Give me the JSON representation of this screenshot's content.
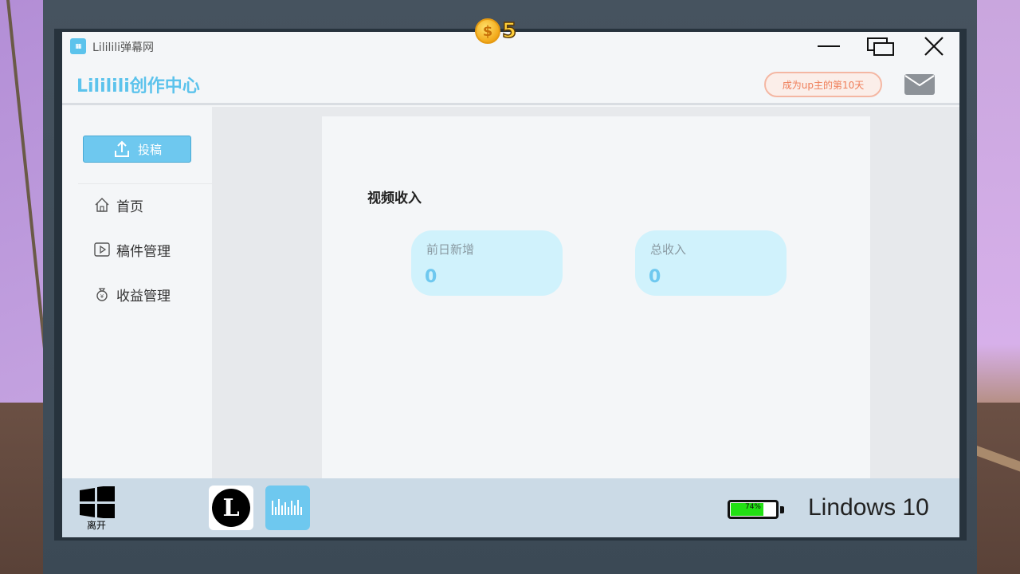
{
  "hud": {
    "coin_icon": "coin-icon",
    "coin_count": "5"
  },
  "window": {
    "title": "Lililili弹幕网",
    "app_icon_text": "lili"
  },
  "header": {
    "brand": "Lililili创作中心",
    "badge": "成为up主的第10天"
  },
  "sidebar": {
    "upload_label": "投稿",
    "items": [
      {
        "label": "首页",
        "icon": "home-icon"
      },
      {
        "label": "稿件管理",
        "icon": "video-icon"
      },
      {
        "label": "收益管理",
        "icon": "money-bag-icon"
      }
    ]
  },
  "main": {
    "section_title": "视频收入",
    "stats": [
      {
        "label": "前日新增",
        "value": "0"
      },
      {
        "label": "总收入",
        "value": "0"
      }
    ]
  },
  "taskbar": {
    "start_label": "离开",
    "app_l_letter": "L",
    "battery_text": "74%",
    "battery_level": 0.74,
    "os_name": "Lindows 10"
  },
  "colors": {
    "accent": "#5cc3ec",
    "badge_text": "#ef7d58",
    "battery": "#22e014"
  }
}
